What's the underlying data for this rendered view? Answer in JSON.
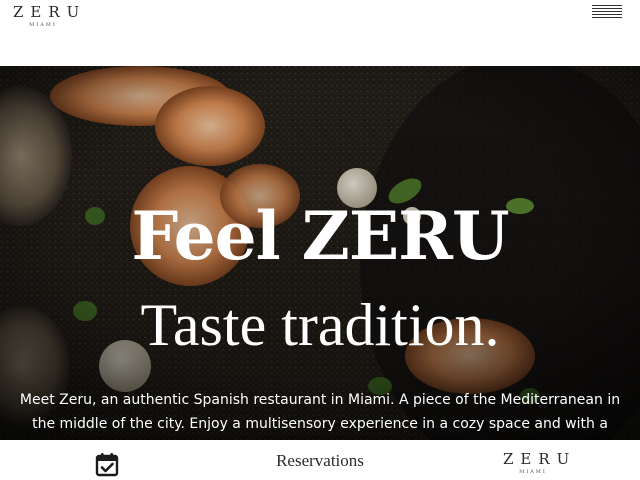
{
  "header": {
    "logo_word": "ZERU",
    "logo_subtitle": "MIAMI",
    "menu_icon": "hamburger-menu-icon"
  },
  "hero": {
    "title": "Feel ZERU",
    "subtitle": "Taste tradition.",
    "text": "Meet Zeru, an authentic Spanish restaurant in Miami. A piece of the Mediterranean in the middle of the city. Enjoy a multisensory experience in a cozy space and with a"
  },
  "bottom_bar": {
    "calendar_icon": "calendar-check-icon",
    "reservations_label": "Reservations",
    "logo_word": "ZERU",
    "logo_subtitle": "MIAMI"
  },
  "colors": {
    "text_dark": "#2b2b2b",
    "hero_text": "#ffffff",
    "background": "#ffffff"
  }
}
